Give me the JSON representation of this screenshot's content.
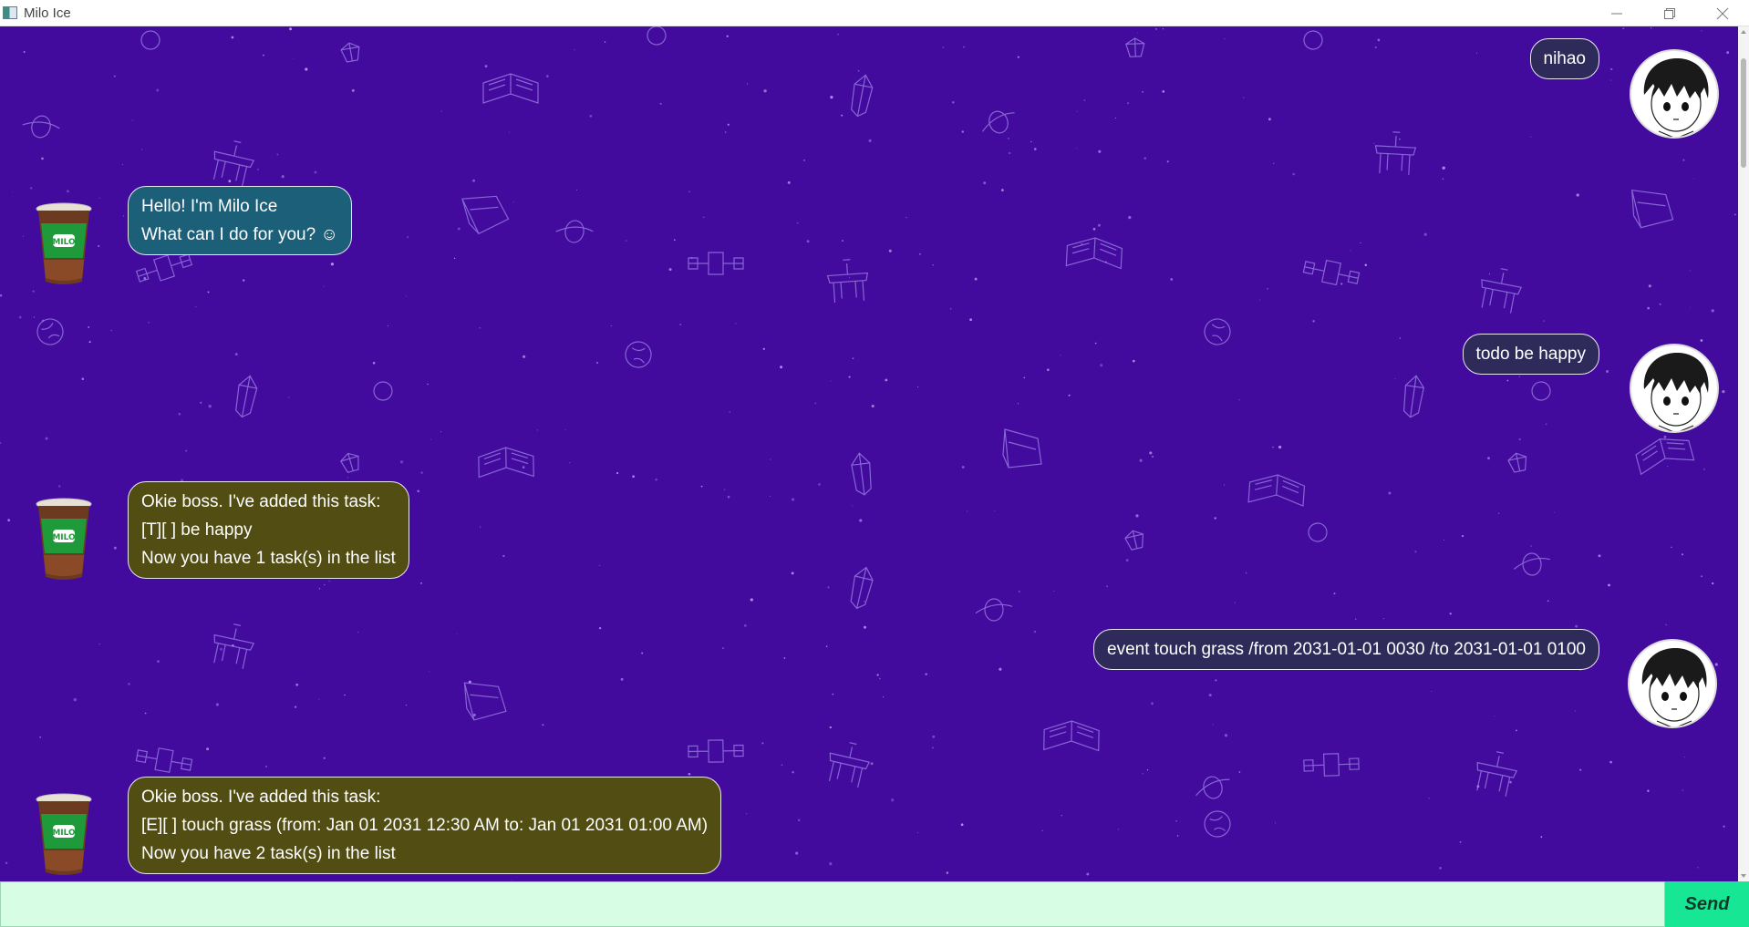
{
  "window": {
    "title": "Milo Ice",
    "controls": {
      "minimize": "minimize-icon",
      "restore": "restore-icon",
      "close": "close-icon"
    }
  },
  "colors": {
    "chat_background": "#430a9e",
    "user_bubble": "#2e2b5a",
    "greeting_bubble": "#1c5f78",
    "task_bubble": "#524d12",
    "input_background": "#d7fde5",
    "send_button": "#17e694"
  },
  "messages": [
    {
      "sender": "user",
      "lines": [
        "nihao"
      ]
    },
    {
      "sender": "bot",
      "style": "greeting",
      "lines": [
        "Hello! I'm Milo Ice",
        "What can I do for you? ☺"
      ]
    },
    {
      "sender": "user",
      "lines": [
        "todo be happy"
      ]
    },
    {
      "sender": "bot",
      "style": "task",
      "lines": [
        "Okie boss. I've added this task:",
        "[T][ ] be happy",
        "Now you have 1 task(s) in the list"
      ]
    },
    {
      "sender": "user",
      "lines": [
        "event touch grass /from 2031-01-01 0030 /to 2031-01-01 0100"
      ]
    },
    {
      "sender": "bot",
      "style": "task",
      "lines": [
        "Okie boss. I've added this task:",
        "[E][ ] touch grass (from: Jan 01 2031 12:30 AM to: Jan 01 2031 01:00 AM)",
        "Now you have 2 task(s) in the list"
      ]
    }
  ],
  "input": {
    "value": "",
    "placeholder": ""
  },
  "send_button": {
    "label": "Send"
  }
}
